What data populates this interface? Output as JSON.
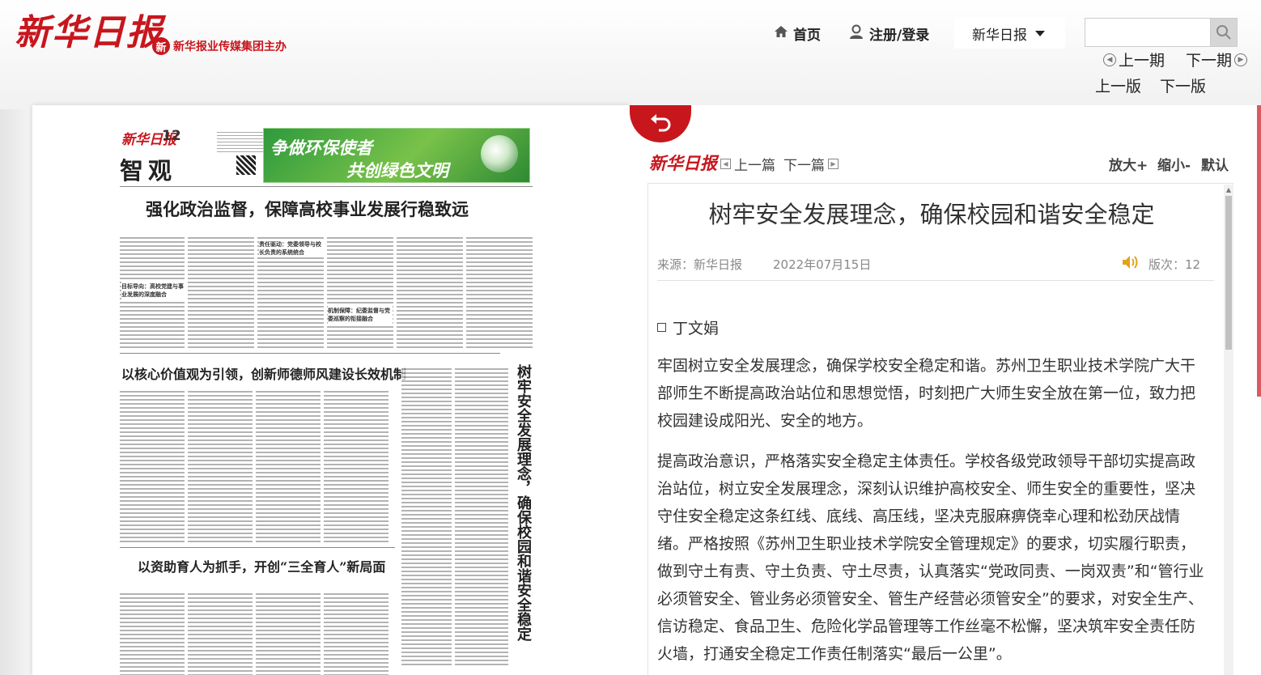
{
  "header": {
    "logo_text": "新华日报",
    "publisher": "新华报业传媒集团主办",
    "publisher_badge": "新",
    "nav": {
      "home": "首页",
      "login": "注册/登录",
      "paper": "新华日报"
    },
    "search": {
      "value": "",
      "placeholder": ""
    },
    "issue_prev": "上一期",
    "issue_next": "下一期",
    "page_prev": "上一版",
    "page_next": "下一版"
  },
  "newspaper": {
    "logo": "新华日报",
    "page_no": "12",
    "section": "智观",
    "banner_line1": "争做环保使者",
    "banner_line2": "共创绿色文明",
    "headline1": "强化政治监督，保障高校事业发展行稳致远",
    "headline2": "以核心价值观为引领，创新师德师风建设长效机制",
    "headline3": "以资助育人为抓手，开创“三全育人”新局面",
    "vertical_headline": "树牢安全发展理念，确保校园和谐安全稳定",
    "sub1": "目标导向：高校党建与事业发展的深度融合",
    "sub2": "责任驱动：党委领导与校长负责的系统统合",
    "sub3": "机制保障：纪委监督与党委巡察的衔接融合"
  },
  "article": {
    "logo": "新华日报",
    "prev_article": "上一篇",
    "next_article": "下一篇",
    "zoom_in": "放大+",
    "zoom_out": "缩小-",
    "zoom_reset": "默认",
    "title": "树牢安全发展理念，确保校园和谐安全稳定",
    "source": "来源：新华日报",
    "date": "2022年07月15日",
    "edition": "版次：12",
    "author": "丁文娟",
    "paragraphs": [
      "牢固树立安全发展理念，确保学校安全稳定和谐。苏州卫生职业技术学院广大干部师生不断提高政治站位和思想觉悟，时刻把广大师生安全放在第一位，致力把校园建设成阳光、安全的地方。",
      "提高政治意识，严格落实安全稳定主体责任。学校各级党政领导干部切实提高政治站位，树立安全发展理念，深刻认识维护高校安全、师生安全的重要性，坚决守住安全稳定这条红线、底线、高压线，坚决克服麻痹侥幸心理和松劲厌战情绪。严格按照《苏州卫生职业技术学院安全管理规定》的要求，切实履行职责，做到守土有责、守土负责、守土尽责，认真落实“党政同责、一岗双责”和“管行业必须管安全、管业务必须管安全、管生产经营必须管安全”的要求，对安全生产、信访稳定、食品卫生、危险化学品管理等工作丝毫不松懈，坚决筑牢安全责任防火墙，打通安全稳定工作责任制落实“最后一公里”。"
    ]
  },
  "colors": {
    "brand_red": "#c8161d",
    "banner_green": "#2e9a3c"
  },
  "icons": [
    "home-icon",
    "user-icon",
    "chevron-down-icon",
    "search-icon",
    "prev-circle-icon",
    "next-circle-icon",
    "back-arrow-icon",
    "prev-square-icon",
    "next-square-icon",
    "speaker-icon"
  ]
}
